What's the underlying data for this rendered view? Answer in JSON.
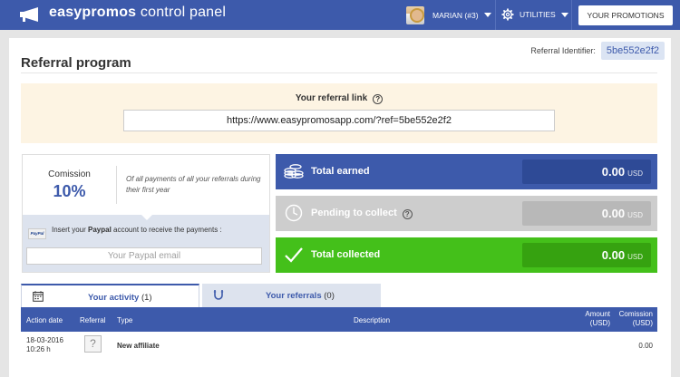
{
  "header": {
    "brand_bold": "easypromos",
    "brand_rest": " control panel",
    "user_name": "MARIAN (#3)",
    "utilities_label": "UTILITIES",
    "promotions_button": "YOUR PROMOTIONS"
  },
  "referral": {
    "identifier_label": "Referral Identifier:",
    "identifier_value": "5be552e2f2",
    "page_title": "Referral program",
    "link_label": "Your referral link",
    "link_value": "https://www.easypromosapp.com/?ref=5be552e2f2"
  },
  "commission": {
    "label": "Comission",
    "value": "10%",
    "description": "Of all payments of all your referrals during their first year",
    "paypal_logo": "PayPal",
    "paypal_prefix": "Insert your ",
    "paypal_bold": "Paypal",
    "paypal_suffix": " account to receive the payments :",
    "paypal_placeholder": "Your Paypal email"
  },
  "stats": [
    {
      "label": "Total earned",
      "value": "0.00",
      "currency": "USD",
      "icon": "coins-icon"
    },
    {
      "label": "Pending to collect",
      "value": "0.00",
      "currency": "USD",
      "icon": "clock-icon"
    },
    {
      "label": "Total collected",
      "value": "0.00",
      "currency": "USD",
      "icon": "checkmark-icon"
    }
  ],
  "tabs": [
    {
      "label": "Your activity",
      "count": "(1)",
      "icon": "calendar-icon",
      "active": true
    },
    {
      "label": "Your referrals",
      "count": "(0)",
      "icon": "magnet-icon",
      "active": false
    }
  ],
  "table": {
    "columns": {
      "action_date": "Action date",
      "referral": "Referral",
      "type": "Type",
      "description": "Description",
      "amount_1": "Amount",
      "amount_2": "(USD)",
      "comission_1": "Comission",
      "comission_2": "(USD)"
    },
    "rows": [
      {
        "date": "18-03-2016",
        "time": "10:26 h",
        "referral_placeholder": "?",
        "type": "New affiliate",
        "description": "",
        "amount": "",
        "comission": "0.00"
      }
    ]
  },
  "colors": {
    "primary": "#3d5aab",
    "pending": "#cdcdcd",
    "collected": "#44c01a",
    "link_box_bg": "#fdf4e3"
  }
}
